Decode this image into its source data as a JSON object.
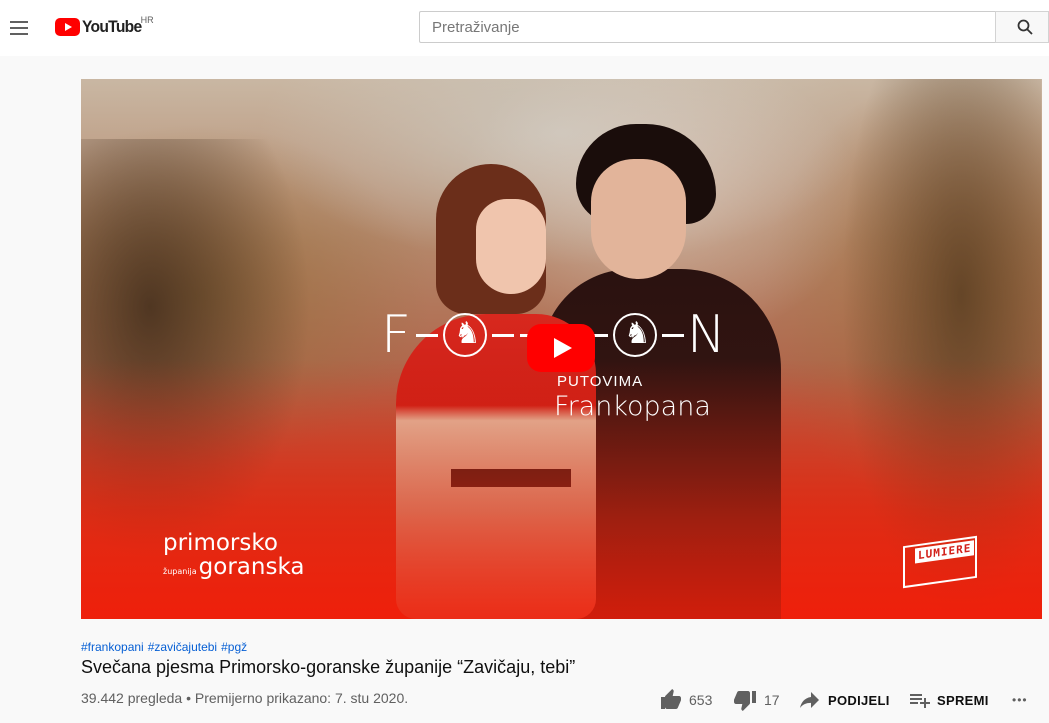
{
  "header": {
    "logo_text": "YouTube",
    "region": "HR",
    "search_placeholder": "Pretraživanje"
  },
  "player": {
    "title_art_letter_left": "F",
    "title_art_letter_right": "N",
    "subtitle_small": "PUTOVIMA",
    "subtitle_big": "Frankopana",
    "brand_left_line1": "primorsko",
    "brand_left_small": "županija",
    "brand_left_line2": "goranska",
    "brand_right": "LUMIERE"
  },
  "video": {
    "hashtags": [
      "#frankopani",
      "#zavičajutebi",
      "#pgž"
    ],
    "title": "Svečana pjesma Primorsko-goranske županije “Zavičaju, tebi”",
    "views": "39.442 pregleda",
    "separator": "•",
    "premiered": "Premijerno prikazano: 7. stu 2020."
  },
  "actions": {
    "likes": "653",
    "dislikes": "17",
    "share_label": "PODIJELI",
    "save_label": "SPREMI",
    "more_label": "•••"
  },
  "icons": {
    "menu": "hamburger-icon",
    "search": "search-icon",
    "like": "thumbs-up-icon",
    "dislike": "thumbs-down-icon",
    "share": "share-arrow-icon",
    "save": "playlist-add-icon",
    "more": "more-horizontal-icon",
    "play": "play-icon"
  },
  "colors": {
    "brand_red": "#ff0000",
    "link_blue": "#065fd4",
    "secondary_text": "#606060"
  }
}
